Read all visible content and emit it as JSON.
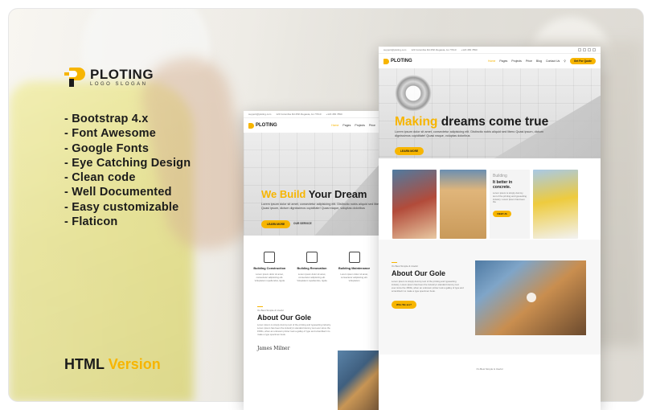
{
  "brand": {
    "name": "PLOTING",
    "slogan": "LOGO SLOGAN"
  },
  "features": [
    "- Bootstrap 4.x",
    "- Font Awesome",
    "- Google Fonts",
    "- Eye Catching Design",
    "- Clean code",
    "- Well Documented",
    "- Easy customizable",
    "- Flaticon"
  ],
  "version": {
    "part1": "HTML",
    "part2": "Version"
  },
  "mock_front": {
    "topbar": {
      "email": "support@ploting.com",
      "address": "123 Columbia Rd 45th Regasta, AL 77010",
      "phone": "+123 456 7890"
    },
    "nav": [
      "Home",
      "Pages",
      "Projects",
      "Price",
      "Blog",
      "Contact Us"
    ],
    "quote_button": "Get For Quote",
    "hero": {
      "title_highlight": "Making",
      "title_rest": " dreams come true",
      "text": "Lorem ipsum dolor sit amet, consectetur adipisicing elit. Distinctio nobis aliquid sed libero Quasi ipsum, dictum dignissimos cupiditate! Quasi eaque, voluptas doloribus",
      "button": "LEARN MORE"
    },
    "gallery_card": {
      "title_small": "Building",
      "title_bold": "It better in concrete.",
      "text": "Lorem ipsum is simply dummy text of the printing and typesetting industry. Lorem Ipsum has been the",
      "button": "VIEW US"
    },
    "about": {
      "tag": "It's Best Simple & Useful",
      "title": "About Our Gole",
      "text": "Lorem Ipsum is simply dummy text of the printing and typesetting industry. Lorem Ipsum has been the industry's standard dummy text ever since the 1500s, when an unknown printer took a galley of type and scrambled it to make a type specimen book.",
      "button": "Who We are?"
    },
    "bottom_tag": "It's Best Simple & Useful"
  },
  "mock_back": {
    "topbar": {
      "email": "support@ploting.com",
      "address": "123 Columbia Rd 45th Regasta, AL 77010",
      "phone": "+123 456 7890"
    },
    "nav": [
      "Home",
      "Pages",
      "Projects",
      "Price"
    ],
    "hero": {
      "title_highlight": "We Build",
      "title_rest": " Your Dream",
      "text": "Lorem ipsum dolor sit amet, consectetur adipisicing elit. Distinctio nobis aliquid sed libero Quasi ipsum, dictum dignissimos cupiditate! Quasi eaque, voluptas doloribus",
      "button": "LEARN MORE",
      "link": "OUR SERVICE"
    },
    "services": [
      {
        "title": "Building Construction",
        "text": "Lorem ipsum dolor sit amet, consectetur adipisicing elit. Voluptatum repellendus, ligula"
      },
      {
        "title": "Building Renovation",
        "text": "Lorem ipsum dolor sit amet, consectetur adipisicing elit. Voluptatum repellendus, ligula"
      },
      {
        "title": "Building Maintenance",
        "text": "Lorem ipsum dolor sit amet, consectetur adipisicing elit. Voluptatum"
      }
    ],
    "about": {
      "tag": "It's Best Simple & Useful",
      "title": "About Our Gole",
      "text": "Lorem Ipsum is simply dummy text of the printing and typesetting industry. Lorem Ipsum has been the industry's standard dummy text ever since the 1500s, when an unknown printer took a galley of type and scrambled it to make a type specimen book.",
      "signature": "James Milner"
    }
  },
  "colors": {
    "accent": "#f7b500",
    "text": "#1b1b1b"
  }
}
